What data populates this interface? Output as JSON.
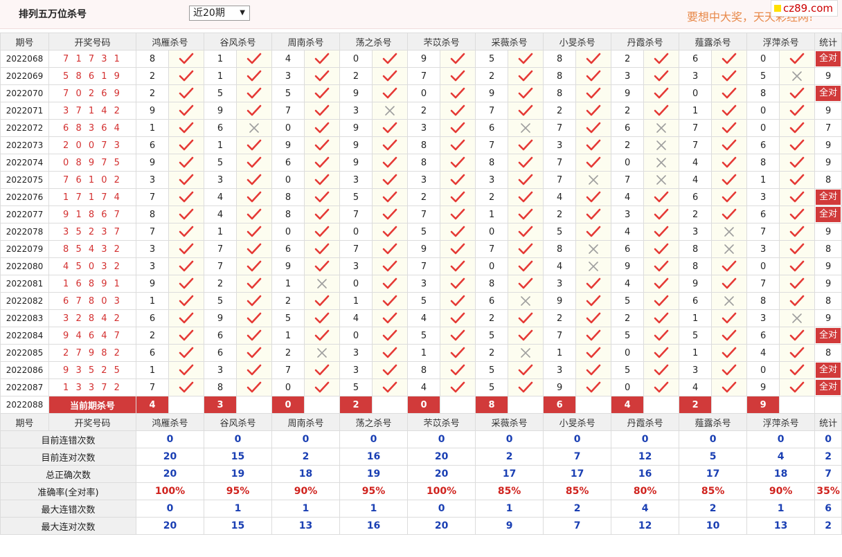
{
  "header": {
    "title": "排列五万位杀号",
    "period_select": "近20期",
    "slogan": "要想中大奖，天天彩经网!",
    "site": "cz89.com"
  },
  "columns": {
    "issue": "期号",
    "draw": "开奖号码",
    "experts": [
      "鸿雁杀号",
      "谷风杀号",
      "周南杀号",
      "荡之杀号",
      "芣苡杀号",
      "采薇杀号",
      "小旻杀号",
      "丹霞杀号",
      "薤露杀号",
      "浮萍杀号"
    ],
    "stat": "统计"
  },
  "rows": [
    {
      "issue": "2022068",
      "draw": "7 1 7 3 1",
      "kills": [
        8,
        1,
        4,
        0,
        9,
        5,
        8,
        2,
        6,
        0
      ],
      "ok": [
        1,
        1,
        1,
        1,
        1,
        1,
        1,
        1,
        1,
        1
      ],
      "stat": "全对"
    },
    {
      "issue": "2022069",
      "draw": "5 8 6 1 9",
      "kills": [
        2,
        1,
        3,
        2,
        7,
        2,
        8,
        3,
        3,
        5
      ],
      "ok": [
        1,
        1,
        1,
        1,
        1,
        1,
        1,
        1,
        1,
        0
      ],
      "stat": "9"
    },
    {
      "issue": "2022070",
      "draw": "7 0 2 6 9",
      "kills": [
        2,
        5,
        5,
        9,
        0,
        9,
        8,
        9,
        0,
        8
      ],
      "ok": [
        1,
        1,
        1,
        1,
        1,
        1,
        1,
        1,
        1,
        1
      ],
      "stat": "全对"
    },
    {
      "issue": "2022071",
      "draw": "3 7 1 4 2",
      "kills": [
        9,
        9,
        7,
        3,
        2,
        7,
        2,
        2,
        1,
        0
      ],
      "ok": [
        1,
        1,
        1,
        0,
        1,
        1,
        1,
        1,
        1,
        1
      ],
      "stat": "9"
    },
    {
      "issue": "2022072",
      "draw": "6 8 3 6 4",
      "kills": [
        1,
        6,
        0,
        9,
        3,
        6,
        7,
        6,
        7,
        0
      ],
      "ok": [
        1,
        0,
        1,
        1,
        1,
        0,
        1,
        0,
        1,
        1
      ],
      "stat": "7"
    },
    {
      "issue": "2022073",
      "draw": "2 0 0 7 3",
      "kills": [
        6,
        1,
        9,
        9,
        8,
        7,
        3,
        2,
        7,
        6
      ],
      "ok": [
        1,
        1,
        1,
        1,
        1,
        1,
        1,
        0,
        1,
        1
      ],
      "stat": "9"
    },
    {
      "issue": "2022074",
      "draw": "0 8 9 7 5",
      "kills": [
        9,
        5,
        6,
        9,
        8,
        8,
        7,
        0,
        4,
        8
      ],
      "ok": [
        1,
        1,
        1,
        1,
        1,
        1,
        1,
        0,
        1,
        1
      ],
      "stat": "9"
    },
    {
      "issue": "2022075",
      "draw": "7 6 1 0 2",
      "kills": [
        3,
        3,
        0,
        3,
        3,
        3,
        7,
        7,
        4,
        1
      ],
      "ok": [
        1,
        1,
        1,
        1,
        1,
        1,
        0,
        0,
        1,
        1
      ],
      "stat": "8"
    },
    {
      "issue": "2022076",
      "draw": "1 7 1 7 4",
      "kills": [
        7,
        4,
        8,
        5,
        2,
        2,
        4,
        4,
        6,
        3
      ],
      "ok": [
        1,
        1,
        1,
        1,
        1,
        1,
        1,
        1,
        1,
        1
      ],
      "stat": "全对"
    },
    {
      "issue": "2022077",
      "draw": "9 1 8 6 7",
      "kills": [
        8,
        4,
        8,
        7,
        7,
        1,
        2,
        3,
        2,
        6
      ],
      "ok": [
        1,
        1,
        1,
        1,
        1,
        1,
        1,
        1,
        1,
        1
      ],
      "stat": "全对"
    },
    {
      "issue": "2022078",
      "draw": "3 5 2 3 7",
      "kills": [
        7,
        1,
        0,
        0,
        5,
        0,
        5,
        4,
        3,
        7
      ],
      "ok": [
        1,
        1,
        1,
        1,
        1,
        1,
        1,
        1,
        0,
        1
      ],
      "stat": "9"
    },
    {
      "issue": "2022079",
      "draw": "8 5 4 3 2",
      "kills": [
        3,
        7,
        6,
        7,
        9,
        7,
        8,
        6,
        8,
        3
      ],
      "ok": [
        1,
        1,
        1,
        1,
        1,
        1,
        0,
        1,
        0,
        1
      ],
      "stat": "8"
    },
    {
      "issue": "2022080",
      "draw": "4 5 0 3 2",
      "kills": [
        3,
        7,
        9,
        3,
        7,
        0,
        4,
        9,
        8,
        0
      ],
      "ok": [
        1,
        1,
        1,
        1,
        1,
        1,
        0,
        1,
        1,
        1
      ],
      "stat": "9"
    },
    {
      "issue": "2022081",
      "draw": "1 6 8 9 1",
      "kills": [
        9,
        2,
        1,
        0,
        3,
        8,
        3,
        4,
        9,
        7
      ],
      "ok": [
        1,
        1,
        0,
        1,
        1,
        1,
        1,
        1,
        1,
        1
      ],
      "stat": "9"
    },
    {
      "issue": "2022082",
      "draw": "6 7 8 0 3",
      "kills": [
        1,
        5,
        2,
        1,
        5,
        6,
        9,
        5,
        6,
        8
      ],
      "ok": [
        1,
        1,
        1,
        1,
        1,
        0,
        1,
        1,
        0,
        1
      ],
      "stat": "8"
    },
    {
      "issue": "2022083",
      "draw": "3 2 8 4 2",
      "kills": [
        6,
        9,
        5,
        4,
        4,
        2,
        2,
        2,
        1,
        3
      ],
      "ok": [
        1,
        1,
        1,
        1,
        1,
        1,
        1,
        1,
        1,
        0
      ],
      "stat": "9"
    },
    {
      "issue": "2022084",
      "draw": "9 4 6 4 7",
      "kills": [
        2,
        6,
        1,
        0,
        5,
        5,
        7,
        5,
        5,
        6
      ],
      "ok": [
        1,
        1,
        1,
        1,
        1,
        1,
        1,
        1,
        1,
        1
      ],
      "stat": "全对"
    },
    {
      "issue": "2022085",
      "draw": "2 7 9 8 2",
      "kills": [
        6,
        6,
        2,
        3,
        1,
        2,
        1,
        0,
        1,
        4
      ],
      "ok": [
        1,
        1,
        0,
        1,
        1,
        0,
        1,
        1,
        1,
        1
      ],
      "stat": "8"
    },
    {
      "issue": "2022086",
      "draw": "9 3 5 2 5",
      "kills": [
        1,
        3,
        7,
        3,
        8,
        5,
        3,
        5,
        3,
        0
      ],
      "ok": [
        1,
        1,
        1,
        1,
        1,
        1,
        1,
        1,
        1,
        1
      ],
      "stat": "全对"
    },
    {
      "issue": "2022087",
      "draw": "1 3 3 7 2",
      "kills": [
        7,
        8,
        0,
        5,
        4,
        5,
        9,
        0,
        4,
        9
      ],
      "ok": [
        1,
        1,
        1,
        1,
        1,
        1,
        1,
        1,
        1,
        1
      ],
      "stat": "全对"
    }
  ],
  "current": {
    "issue": "2022088",
    "label": "当前期杀号",
    "kills": [
      4,
      3,
      0,
      2,
      0,
      8,
      6,
      4,
      2,
      9
    ]
  },
  "summary": [
    {
      "label": "目前连错次数",
      "values": [
        "0",
        "0",
        "0",
        "0",
        "0",
        "0",
        "0",
        "0",
        "0",
        "0",
        "0"
      ],
      "red": false
    },
    {
      "label": "目前连对次数",
      "values": [
        "20",
        "15",
        "2",
        "16",
        "20",
        "2",
        "7",
        "12",
        "5",
        "4",
        "2"
      ],
      "red": false
    },
    {
      "label": "总正确次数",
      "values": [
        "20",
        "19",
        "18",
        "19",
        "20",
        "17",
        "17",
        "16",
        "17",
        "18",
        "7"
      ],
      "red": false
    },
    {
      "label": "准确率(全对率)",
      "values": [
        "100%",
        "95%",
        "90%",
        "95%",
        "100%",
        "85%",
        "85%",
        "80%",
        "85%",
        "90%",
        "35%"
      ],
      "red": true
    },
    {
      "label": "最大连错次数",
      "values": [
        "0",
        "1",
        "1",
        "1",
        "0",
        "1",
        "2",
        "4",
        "2",
        "1",
        "6"
      ],
      "red": false
    },
    {
      "label": "最大连对次数",
      "values": [
        "20",
        "15",
        "13",
        "16",
        "20",
        "9",
        "7",
        "12",
        "10",
        "13",
        "2"
      ],
      "red": false
    }
  ],
  "icons": {
    "correct": "check-icon",
    "wrong": "cross-icon"
  },
  "colors": {
    "check": "#e53935",
    "cross": "#9e9e9e",
    "red": "#d13a3a",
    "blue": "#1a3fb3",
    "slogan": "#e8894a"
  }
}
